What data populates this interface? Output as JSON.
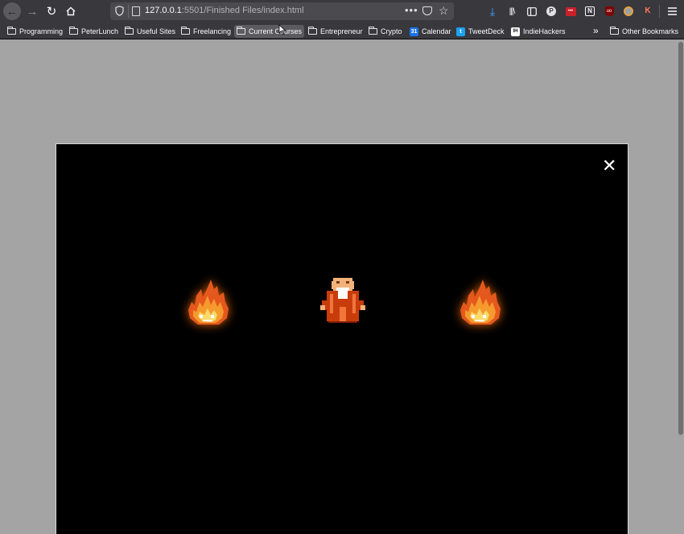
{
  "browser": {
    "url_host": "127.0.0.1",
    "url_rest": ":5501/Finished Files/index.html",
    "toolbar_icons": [
      "download-icon",
      "library-icon",
      "sidebar-icon",
      "pocket-extension-icon",
      "lastpass-icon",
      "notion-icon",
      "ublock-icon",
      "extension-icon",
      "kami-icon",
      "menu-icon"
    ]
  },
  "bookmarks": [
    {
      "label": "Programming",
      "icon": "folder-icon"
    },
    {
      "label": "PeterLunch",
      "icon": "folder-icon"
    },
    {
      "label": "Useful Sites",
      "icon": "folder-icon"
    },
    {
      "label": "Freelancing",
      "icon": "folder-icon"
    },
    {
      "label": "Current Courses",
      "icon": "folder-icon"
    },
    {
      "label": "Entrepreneur",
      "icon": "folder-icon"
    },
    {
      "label": "Crypto",
      "icon": "folder-icon"
    },
    {
      "label": "Calendar",
      "icon": "calendar-icon",
      "color": "#1a73e8",
      "glyph": "31"
    },
    {
      "label": "TweetDeck",
      "icon": "twitter-icon",
      "color": "#1da1f2",
      "glyph": "t"
    },
    {
      "label": "IndieHackers",
      "icon": "indiehackers-icon",
      "color": "#ffffff",
      "glyph": "IH"
    }
  ],
  "other_bookmarks": "Other Bookmarks",
  "modal": {
    "close_symbol": "✕",
    "sprites": [
      "fire-left",
      "old-man",
      "fire-right"
    ]
  },
  "colors": {
    "toolbar": "#38383d",
    "page_bg": "#a4a4a5",
    "modal_bg": "#000000",
    "fire": "#f5a623",
    "robe": "#c83c0c"
  }
}
